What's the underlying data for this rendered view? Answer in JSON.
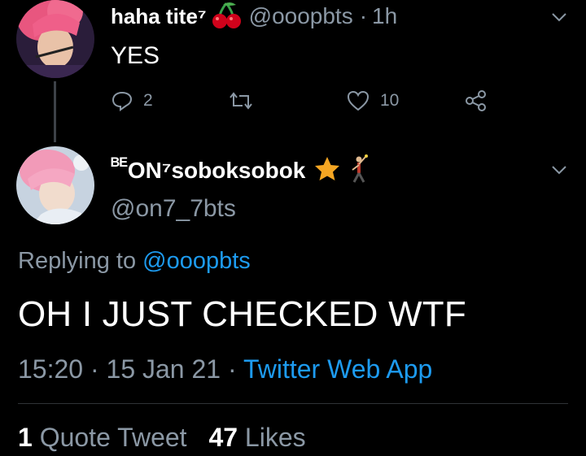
{
  "parent_tweet": {
    "display_name": "haha tite⁷",
    "name_emoji": "cherries-icon",
    "handle": "@ooopbts",
    "separator": "·",
    "time": "1h",
    "text": "YES",
    "reply_count": "2",
    "like_count": "10"
  },
  "reply_tweet": {
    "display_name_prefix": "ᴮᴱ",
    "display_name": "ON⁷soboksobok",
    "name_emojis": [
      "star-icon",
      "dancing-figure-icon"
    ],
    "handle": "@on7_7bts",
    "replying_prefix": "Replying to",
    "replying_to": "@ooopbts",
    "text": "OH I JUST CHECKED WTF",
    "time": "15:20",
    "separator": "·",
    "date": "15 Jan 21",
    "source": "Twitter Web App"
  },
  "stats": {
    "quote_count": "1",
    "quote_label": "Quote Tweet",
    "likes_count": "47",
    "likes_label": "Likes"
  },
  "colors": {
    "background": "#000000",
    "secondary_text": "#8b98a5",
    "link": "#1d9bf0",
    "star": "#f5a623",
    "cherry": "#d0021b"
  }
}
